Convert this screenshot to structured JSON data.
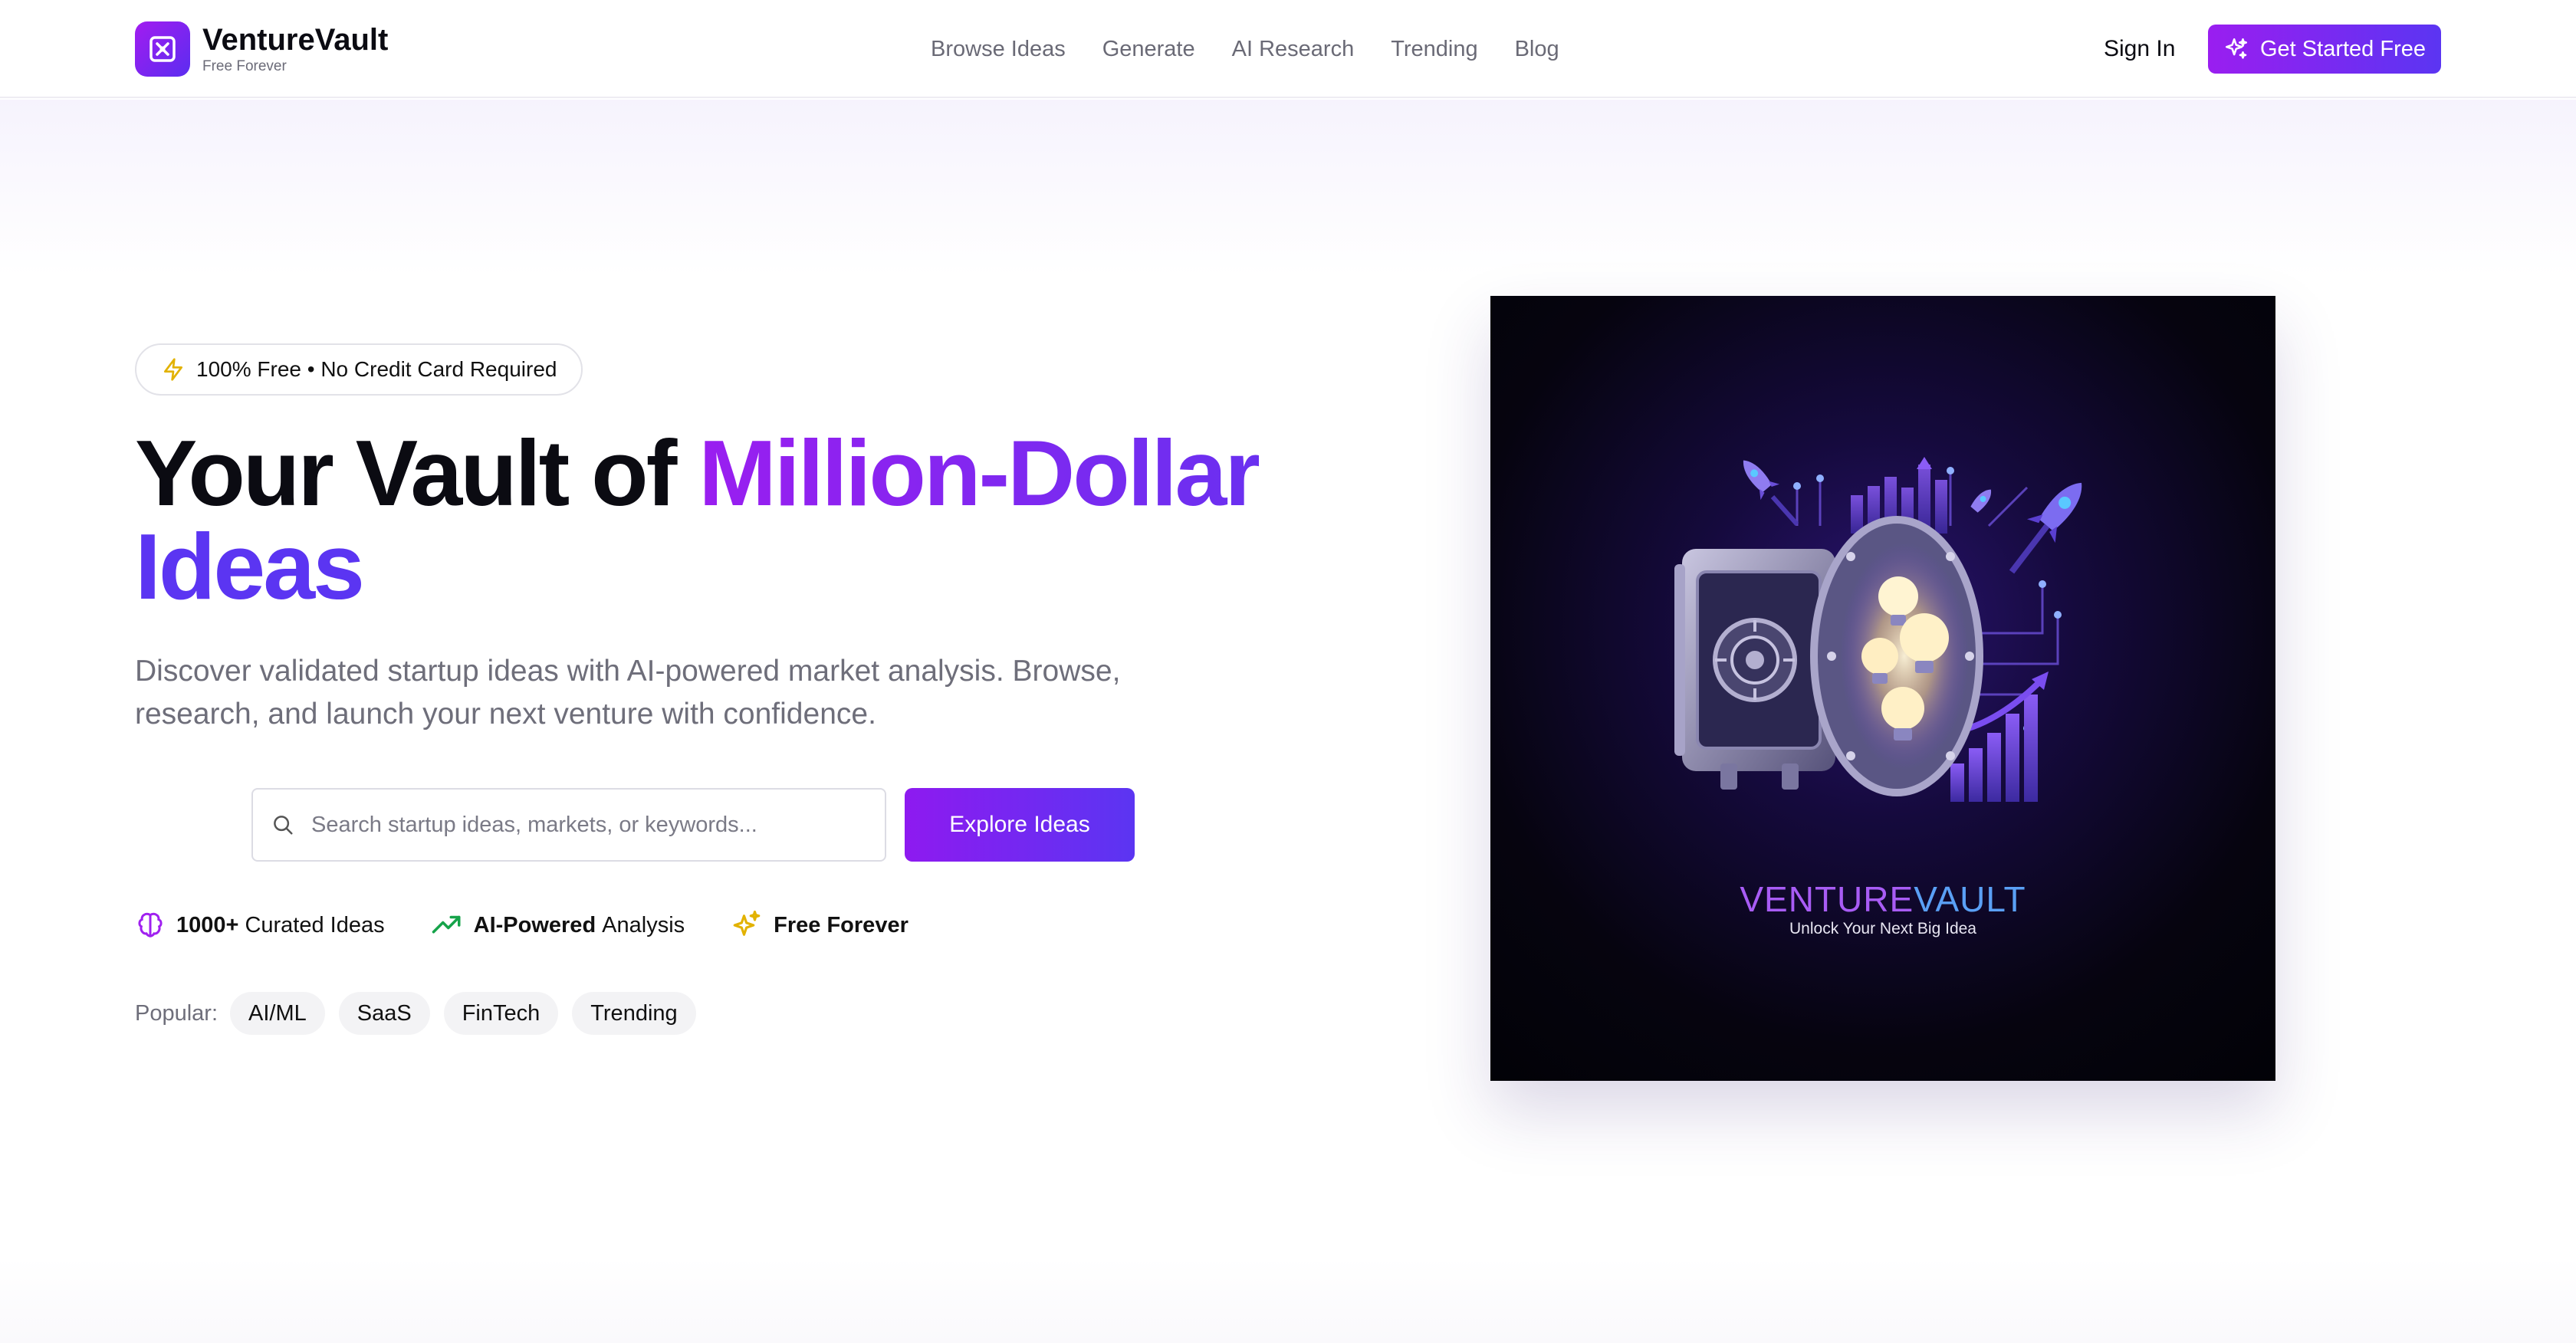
{
  "header": {
    "brand": "VentureVault",
    "brand_sub": "Free Forever",
    "nav": [
      "Browse Ideas",
      "Generate",
      "AI Research",
      "Trending",
      "Blog"
    ],
    "sign_in": "Sign In",
    "cta": "Get Started Free"
  },
  "hero": {
    "badge": "100% Free • No Credit Card Required",
    "headline_part1": "Your Vault of ",
    "headline_part2": "Million-Dollar",
    "headline_part3": "Ideas",
    "subtitle": "Discover validated startup ideas with AI-powered market analysis. Browse, research, and launch your next venture with confidence.",
    "search_placeholder": "Search startup ideas, markets, or keywords...",
    "search_value": "",
    "explore_button": "Explore Ideas",
    "features": [
      {
        "icon": "brain-icon",
        "bold": "1000+",
        "text": "Curated Ideas"
      },
      {
        "icon": "trending-up-icon",
        "bold": "AI-Powered",
        "text": "Analysis"
      },
      {
        "icon": "sparkles-icon",
        "bold": "Free Forever",
        "text": ""
      }
    ],
    "popular_label": "Popular:",
    "popular_tags": [
      "AI/ML",
      "SaaS",
      "FinTech",
      "Trending"
    ]
  },
  "illustration": {
    "title_part1": "VENTURE",
    "title_part2": "VAULT",
    "tagline": "Unlock Your Next Big Idea"
  },
  "colors": {
    "accent_purple": "#9a1ef0",
    "accent_indigo": "#5b35f2",
    "text_dark": "#0b0b12",
    "text_muted": "#6e6e7a",
    "icon_yellow": "#e2b200",
    "icon_green": "#16a34a",
    "icon_violet": "#a020f0"
  }
}
